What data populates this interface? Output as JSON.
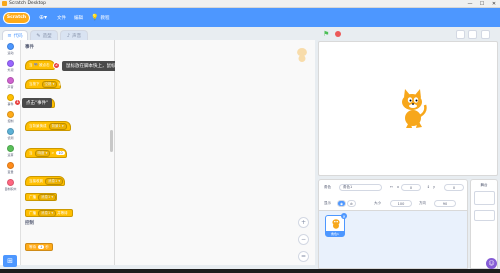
{
  "window": {
    "title": "Scratch Desktop",
    "controls": [
      "—",
      "☐",
      "✕"
    ]
  },
  "menubar": {
    "logo": "Scratch",
    "items": [
      {
        "label": "",
        "icon": "globe-icon",
        "glyph": "⊕▾"
      },
      {
        "label": "文件",
        "icon": ""
      },
      {
        "label": "编辑",
        "icon": ""
      },
      {
        "label": "教程",
        "icon": "lightbulb-icon",
        "glyph": "💡"
      }
    ]
  },
  "tabs": [
    {
      "label": "代码",
      "glyph": "≡"
    },
    {
      "label": "造型",
      "glyph": "✎"
    },
    {
      "label": "声音",
      "glyph": "♪"
    }
  ],
  "categories": [
    {
      "label": "运动",
      "color": "#4c97ff"
    },
    {
      "label": "外观",
      "color": "#9966ff"
    },
    {
      "label": "声音",
      "color": "#cf63cf"
    },
    {
      "label": "事件",
      "color": "#ffbf00"
    },
    {
      "label": "控制",
      "color": "#ffab19"
    },
    {
      "label": "侦测",
      "color": "#5cb1d6"
    },
    {
      "label": "运算",
      "color": "#59c059"
    },
    {
      "label": "变量",
      "color": "#ff8c1a"
    },
    {
      "label": "自制积木",
      "color": "#ff6680"
    }
  ],
  "palette": {
    "events_title": "事件",
    "control_title": "控制",
    "blocks": [
      {
        "text": "当 🏁 被点击"
      },
      {
        "text": "当按下",
        "pill": "空格 ▾",
        "tail": "键"
      },
      {
        "text": "当角色被点击"
      },
      {
        "text": "当背景换成",
        "pill": "背景1 ▾"
      },
      {
        "text": "当",
        "pill": "响度 ▾",
        "tail": ">",
        "num": "10"
      },
      {
        "text": "当接收到",
        "pill": "消息1 ▾"
      },
      {
        "text": "广播",
        "pill": "消息1 ▾"
      },
      {
        "text": "广播",
        "pill": "消息1 ▾",
        "tail": "并等待"
      },
      {
        "text": "等待",
        "num": "1",
        "tail": "秒"
      }
    ]
  },
  "callouts": {
    "tip1": {
      "badge": "2",
      "text": "鼠标放在脚本快上，鼠标变成手型时，按住左键拖动到右边\"脚本区\""
    },
    "tip2": {
      "badge": "1",
      "text": "点击\"事件\""
    }
  },
  "code_area": {
    "zoom": [
      "+",
      "−",
      "="
    ]
  },
  "sprite_info": {
    "sprite_label": "角色",
    "sprite_name": "角色1",
    "x_label": "x",
    "x_value": "0",
    "y_label": "y",
    "y_value": "0",
    "show_label": "显示",
    "size_label": "大小",
    "size_value": "100",
    "direction_label": "方向",
    "direction_value": "90"
  },
  "sprites": [
    {
      "name": "角色1"
    }
  ],
  "stage_pane": {
    "title": "舞台",
    "backdrops_label": "背景",
    "backdrop_count": "1"
  },
  "colors": {
    "accent": "#4d97ff",
    "events": "#ffbf00",
    "callout_badge": "#e8403f"
  }
}
